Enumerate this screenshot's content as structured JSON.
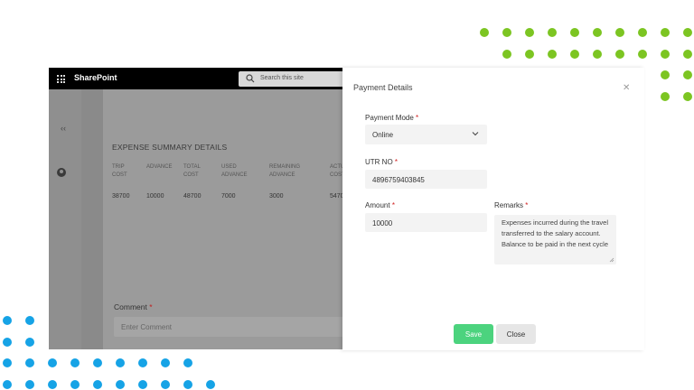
{
  "sharepoint": {
    "app_title": "SharePoint",
    "search_placeholder": "Search this site",
    "section_title": "EXPENSE SUMMARY DETAILS",
    "columns": [
      {
        "header_line1": "TRIP",
        "header_line2": "COST",
        "value": "38700"
      },
      {
        "header_line1": "ADVANCE",
        "header_line2": "",
        "value": "10000"
      },
      {
        "header_line1": "TOTAL",
        "header_line2": "COST",
        "value": "48700"
      },
      {
        "header_line1": "USED",
        "header_line2": "ADVANCE",
        "value": "7000"
      },
      {
        "header_line1": "REMAINING",
        "header_line2": "ADVANCE",
        "value": "3000"
      },
      {
        "header_line1": "ACTU",
        "header_line2": "COST",
        "value": "5470"
      }
    ],
    "comment_label": "Comment",
    "comment_required": "*",
    "comment_placeholder": "Enter Comment"
  },
  "dialog": {
    "title": "Payment Details",
    "payment_mode_label": "Payment Mode",
    "payment_mode_value": "Online",
    "utr_label": "UTR NO",
    "utr_value": "4896759403845",
    "amount_label": "Amount",
    "amount_value": "10000",
    "remarks_label": "Remarks",
    "remarks_value": "Expenses incurred during the travel transferred to the salary account. Balance to be paid in the next cycle",
    "required_mark": "*",
    "save_label": "Save",
    "close_label": "Close"
  },
  "colors": {
    "accent_green": "#4cd37e",
    "dot_green": "#7cc522",
    "dot_blue": "#16a3e6",
    "required_red": "#d02020"
  }
}
